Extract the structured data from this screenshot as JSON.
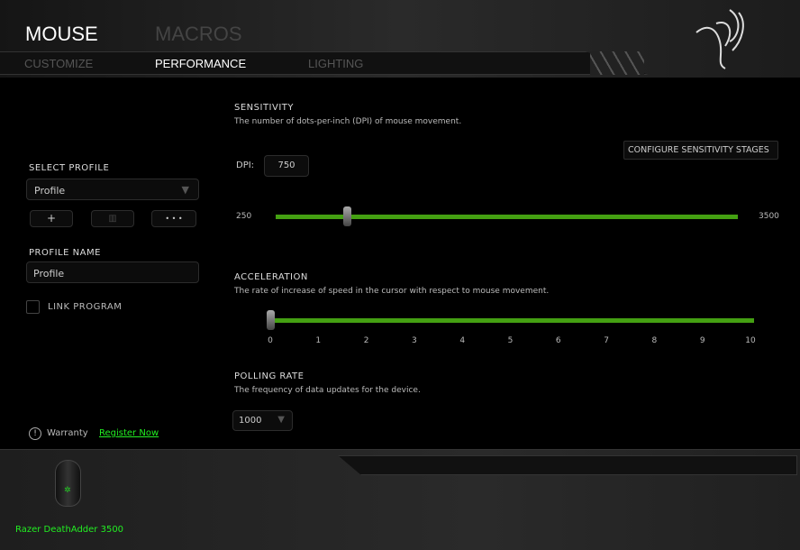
{
  "header": {
    "tabs": [
      {
        "label": "MOUSE",
        "active": true
      },
      {
        "label": "MACROS",
        "active": false
      }
    ],
    "subtabs": [
      {
        "label": "CUSTOMIZE",
        "active": false
      },
      {
        "label": "PERFORMANCE",
        "active": true
      },
      {
        "label": "LIGHTING",
        "active": false
      }
    ],
    "logo": "razer-snake-logo"
  },
  "sidebar": {
    "select_profile_label": "SELECT PROFILE",
    "profile_value": "Profile",
    "profile_name_label": "PROFILE NAME",
    "profile_name_value": "Profile",
    "link_program_label": "LINK PROGRAM",
    "link_program_checked": false,
    "add_label": "+",
    "more_label": "• • •",
    "warranty_label": "Warranty",
    "register_label": "Register Now"
  },
  "sensitivity": {
    "title": "SENSITIVITY",
    "description": "The number of dots-per-inch (DPI) of mouse movement.",
    "configure_label": "CONFIGURE SENSITIVITY STAGES",
    "dpi_label": "DPI:",
    "dpi_value": "750",
    "min": "250",
    "max": "3500",
    "value": 750
  },
  "acceleration": {
    "title": "ACCELERATION",
    "description": "The rate of increase of speed in the cursor with respect to mouse movement.",
    "ticks": [
      "0",
      "1",
      "2",
      "3",
      "4",
      "5",
      "6",
      "7",
      "8",
      "9",
      "10"
    ],
    "value": 0
  },
  "polling": {
    "title": "POLLING RATE",
    "description": "The frequency of data updates for the device.",
    "value": "1000"
  },
  "device": {
    "name": "Razer DeathAdder 3500"
  },
  "colors": {
    "accent": "#44a012",
    "link": "#22ee22"
  }
}
